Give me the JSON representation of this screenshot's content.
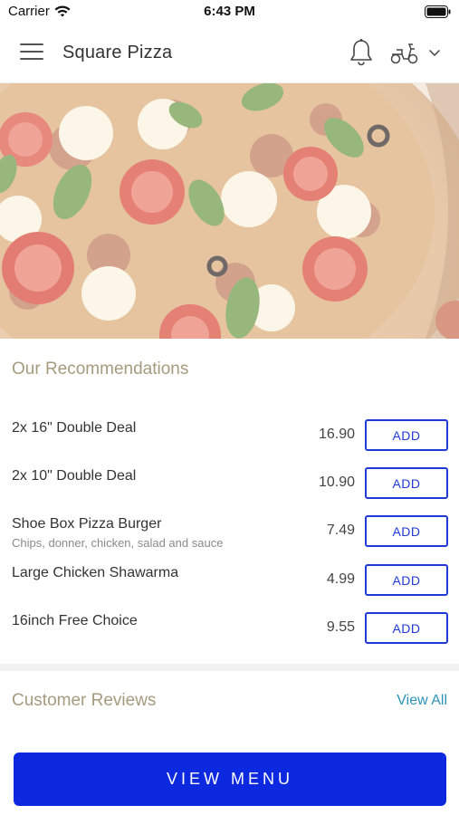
{
  "status_bar": {
    "carrier": "Carrier",
    "time": "6:43 PM",
    "icons": [
      "wifi-icon",
      "battery-icon"
    ]
  },
  "header": {
    "title": "Square Pizza",
    "icons": [
      "hamburger-menu-icon",
      "bell-icon",
      "scooter-icon",
      "chevron-down-icon"
    ]
  },
  "recommendations": {
    "title": "Our Recommendations",
    "items": [
      {
        "name": "2x 16\" Double Deal",
        "description": "",
        "price": "16.90",
        "button": "ADD"
      },
      {
        "name": "2x 10\" Double Deal",
        "description": "",
        "price": "10.90",
        "button": "ADD"
      },
      {
        "name": "Shoe Box Pizza Burger",
        "description": "Chips, donner, chicken, salad and sauce",
        "price": "7.49",
        "button": "ADD"
      },
      {
        "name": "Large Chicken Shawarma",
        "description": "",
        "price": "4.99",
        "button": "ADD"
      },
      {
        "name": "16inch Free Choice",
        "description": "",
        "price": "9.55",
        "button": "ADD"
      }
    ]
  },
  "reviews": {
    "title": "Customer Reviews",
    "view_all": "View All"
  },
  "cta": {
    "label": "VIEW MENU"
  },
  "colors": {
    "accent_blue": "#0d29e0",
    "add_button_blue": "#1f3ad6",
    "section_title": "#a59b7f",
    "link": "#2c93b8"
  }
}
